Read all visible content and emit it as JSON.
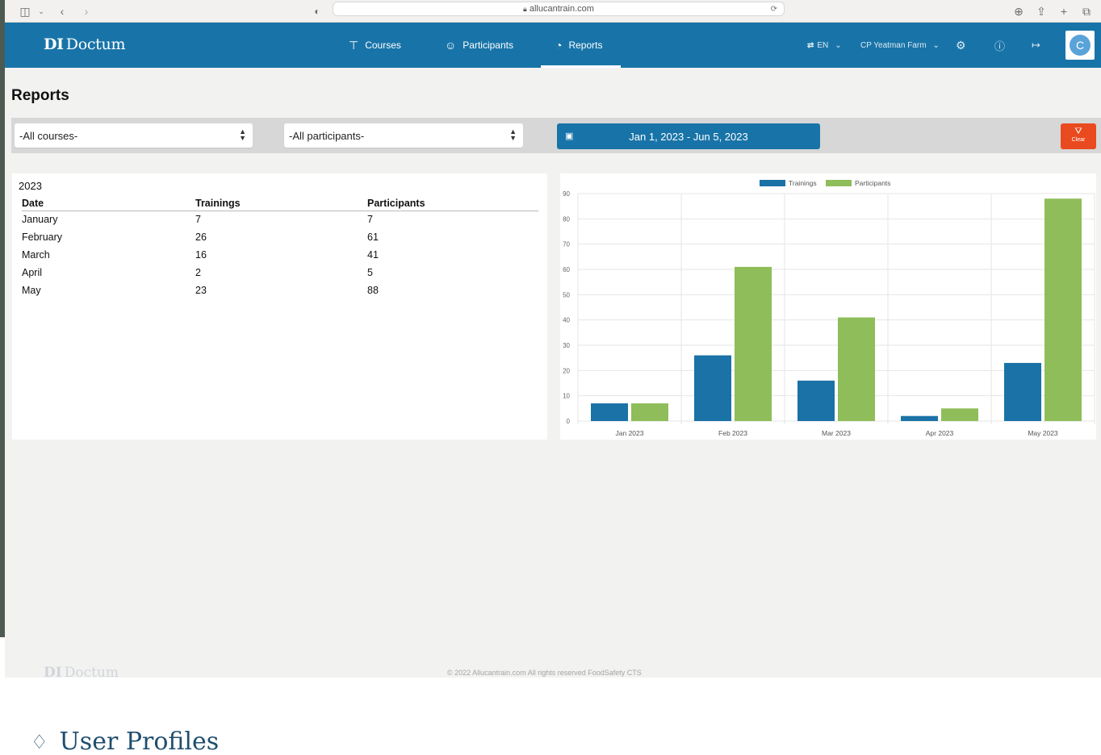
{
  "browser": {
    "url": "allucantrain.com"
  },
  "header": {
    "logo_mark": "DI",
    "logo_text": "Doctum",
    "nav": [
      {
        "label": "Courses",
        "icon": "graduation-cap-icon"
      },
      {
        "label": "Participants",
        "icon": "user-icon"
      },
      {
        "label": "Reports",
        "icon": "pie-chart-icon",
        "active": true
      }
    ],
    "language": "EN",
    "organization": "CP Yeatman Farm",
    "avatar_initial": "C"
  },
  "page": {
    "title": "Reports"
  },
  "filters": {
    "course_select": "-All courses-",
    "participant_select": "-All participants-",
    "date_range": "Jan 1, 2023 - Jun 5, 2023",
    "clear_label": "Clear"
  },
  "report_table": {
    "year": "2023",
    "columns": [
      "Date",
      "Trainings",
      "Participants"
    ],
    "rows": [
      [
        "January",
        "7",
        "7"
      ],
      [
        "February",
        "26",
        "61"
      ],
      [
        "March",
        "16",
        "41"
      ],
      [
        "April",
        "2",
        "5"
      ],
      [
        "May",
        "23",
        "88"
      ]
    ]
  },
  "chart_data": {
    "type": "bar",
    "categories": [
      "Jan 2023",
      "Feb 2023",
      "Mar 2023",
      "Apr 2023",
      "May 2023"
    ],
    "series": [
      {
        "name": "Trainings",
        "values": [
          7,
          26,
          16,
          2,
          23
        ],
        "color": "#1a72a6"
      },
      {
        "name": "Participants",
        "values": [
          7,
          61,
          41,
          5,
          88
        ],
        "color": "#8fbd59"
      }
    ],
    "ylim": [
      0,
      90
    ],
    "yticks": [
      0,
      10,
      20,
      30,
      40,
      50,
      60,
      70,
      80,
      90
    ],
    "grid": true,
    "legend": "top-center"
  },
  "footer": {
    "logo_text": "Doctum",
    "copyright": "© 2022 Allucantrain.com All rights reserved FoodSafety CTS"
  },
  "doc": {
    "heading": "User Profiles"
  }
}
